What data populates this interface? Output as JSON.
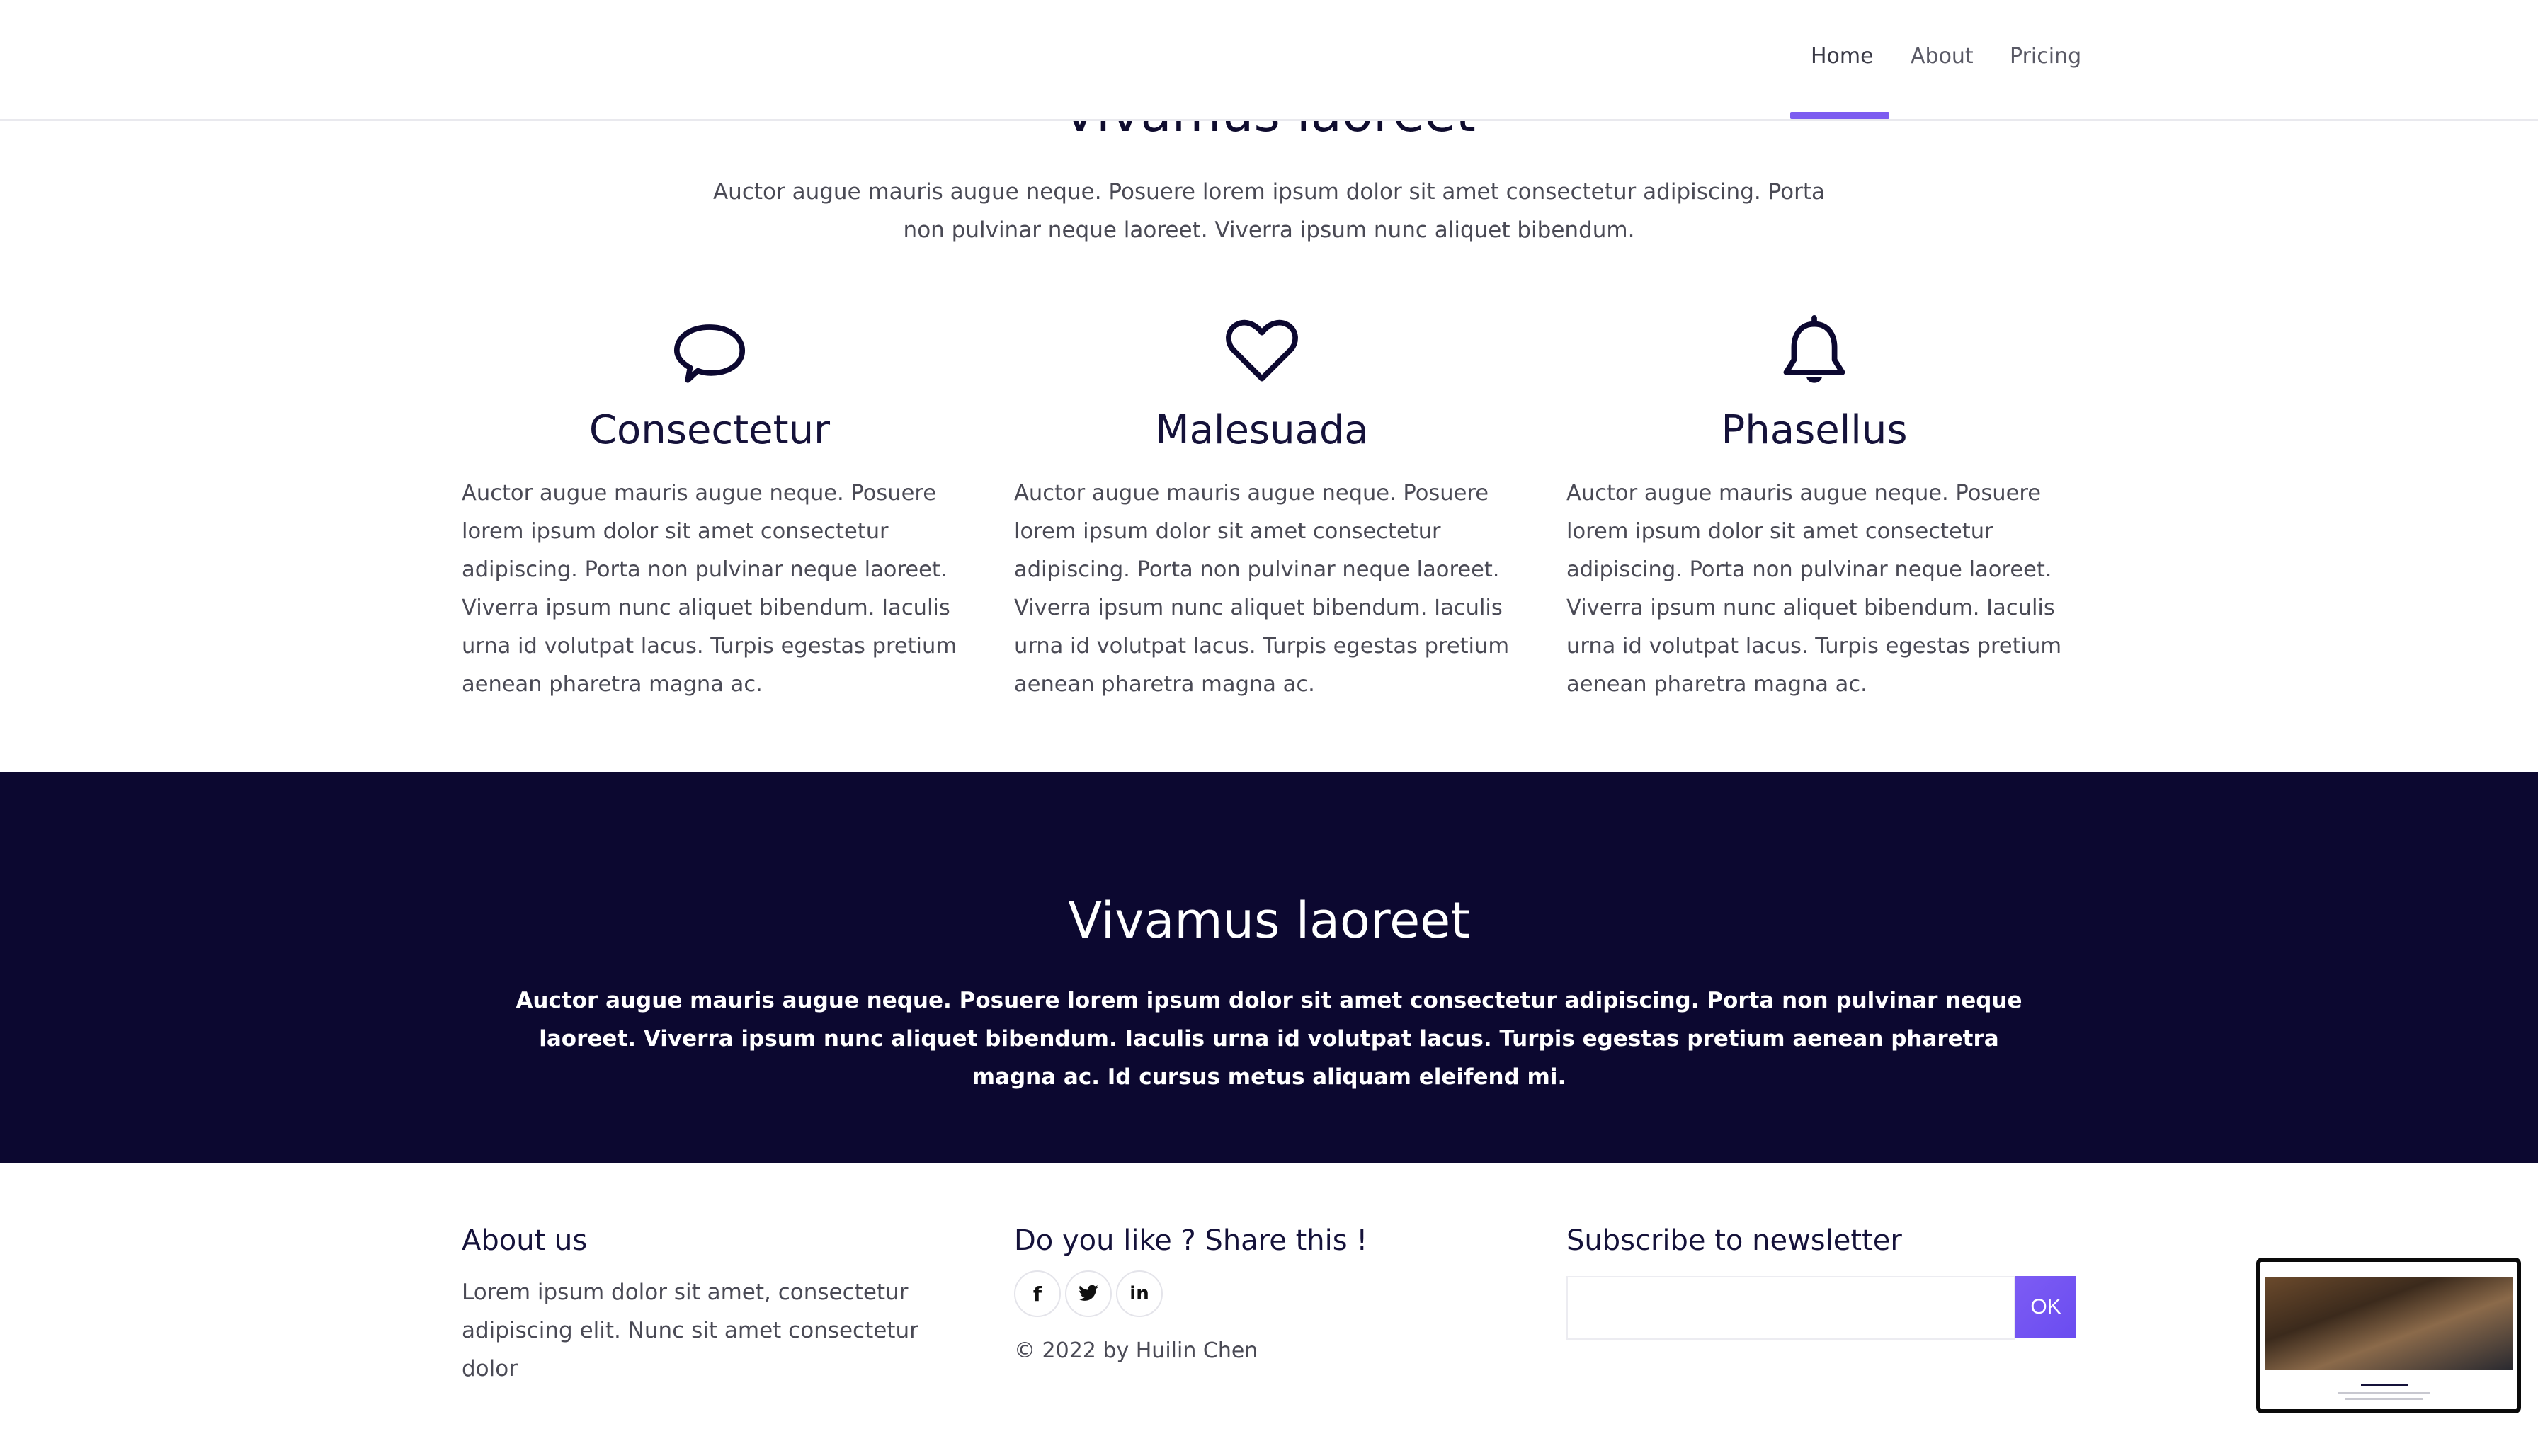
{
  "nav": {
    "items": [
      {
        "label": "Home",
        "active": true
      },
      {
        "label": "About",
        "active": false
      },
      {
        "label": "Pricing",
        "active": false
      }
    ],
    "accent_color": "#7c5cf0"
  },
  "hero": {
    "heading": "Vivamus laoreet",
    "intro": "Auctor augue mauris augue neque. Posuere lorem ipsum dolor sit amet consectetur adipiscing. Porta non pulvinar neque laoreet. Viverra ipsum nunc aliquet bibendum."
  },
  "features": [
    {
      "icon": "chat-bubble-icon",
      "title": "Consectetur",
      "text": "Auctor augue mauris augue neque. Posuere lorem ipsum dolor sit amet consectetur adipiscing. Porta non pulvinar neque laoreet. Viverra ipsum nunc aliquet bibendum. Iaculis urna id volutpat lacus. Turpis egestas pretium aenean pharetra magna ac."
    },
    {
      "icon": "heart-icon",
      "title": "Malesuada",
      "text": "Auctor augue mauris augue neque. Posuere lorem ipsum dolor sit amet consectetur adipiscing. Porta non pulvinar neque laoreet. Viverra ipsum nunc aliquet bibendum. Iaculis urna id volutpat lacus. Turpis egestas pretium aenean pharetra magna ac."
    },
    {
      "icon": "bell-icon",
      "title": "Phasellus",
      "text": "Auctor augue mauris augue neque. Posuere lorem ipsum dolor sit amet consectetur adipiscing. Porta non pulvinar neque laoreet. Viverra ipsum nunc aliquet bibendum. Iaculis urna id volutpat lacus. Turpis egestas pretium aenean pharetra magna ac."
    }
  ],
  "band": {
    "title": "Vivamus laoreet",
    "text": "Auctor augue mauris augue neque. Posuere lorem ipsum dolor sit amet consectetur adipiscing. Porta non pulvinar neque laoreet. Viverra ipsum nunc aliquet bibendum. Iaculis urna id volutpat lacus. Turpis egestas pretium aenean pharetra magna ac. Id cursus metus aliquam eleifend mi.",
    "background": "#0c0830"
  },
  "footer": {
    "about": {
      "heading": "About us",
      "text": "Lorem ipsum dolor sit amet, consectetur adipiscing elit. Nunc sit amet consectetur dolor"
    },
    "share": {
      "heading": "Do you like ? Share this !",
      "icons": [
        {
          "name": "facebook-icon",
          "glyph": "f"
        },
        {
          "name": "twitter-icon",
          "glyph": "🐦"
        },
        {
          "name": "linkedin-icon",
          "glyph": "in"
        }
      ],
      "copyright": "© 2022 by Huilin Chen"
    },
    "newsletter": {
      "heading": "Subscribe to newsletter",
      "input_value": "",
      "button_label": "OK"
    }
  }
}
